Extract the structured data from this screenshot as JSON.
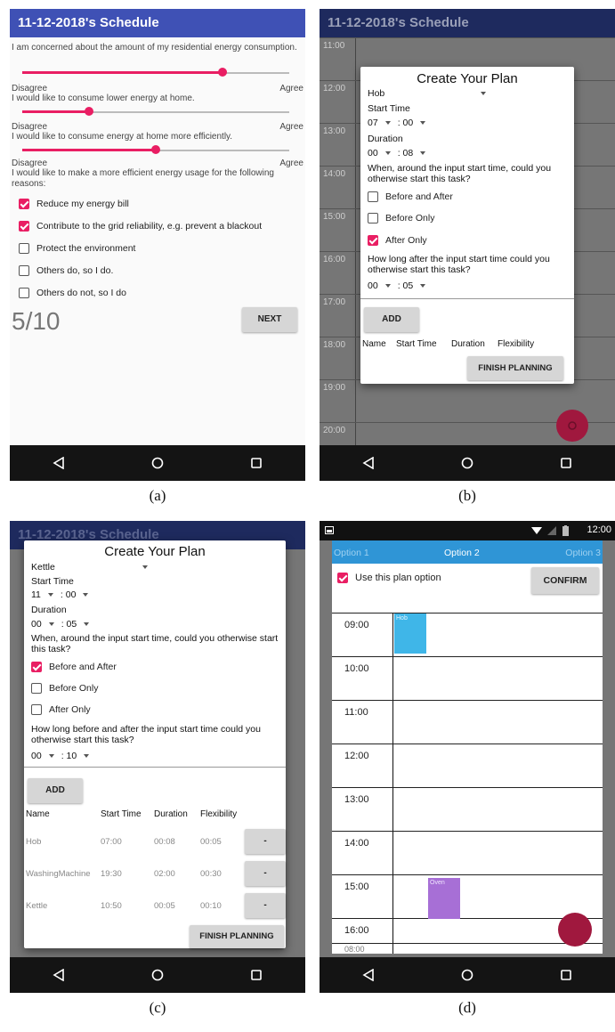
{
  "panels": {
    "a": {
      "label": "(a)",
      "app_title": "11-12-2018's Schedule",
      "questions": [
        {
          "text": "I am concerned about the amount of my residential energy consumption.",
          "value": 0.75
        },
        {
          "text": "I would like to consume lower energy at home.",
          "value": 0.25
        },
        {
          "text": "I would like to consume energy at home more efficiently.",
          "value": 0.5
        }
      ],
      "scale_min": "Disagree",
      "scale_max": "Agree",
      "reasons_prompt": "I would like to make a more efficient energy usage for the following reasons:",
      "reasons": [
        {
          "label": "Reduce my energy bill",
          "checked": true
        },
        {
          "label": "Contribute to the grid reliability, e.g. prevent a blackout",
          "checked": true
        },
        {
          "label": "Protect the environment",
          "checked": false
        },
        {
          "label": "Others do, so I do.",
          "checked": false
        },
        {
          "label": "Others do not, so I do",
          "checked": false
        }
      ],
      "progress": "5/10",
      "next_label": "NEXT"
    },
    "b": {
      "label": "(b)",
      "app_title": "11-12-2018's Schedule",
      "hours": [
        "11:00",
        "12:00",
        "13:00",
        "14:00",
        "15:00",
        "16:00",
        "17:00",
        "18:00",
        "19:00",
        "20:00"
      ],
      "dialog": {
        "title": "Create Your Plan",
        "appliance": "Hob",
        "start_time_label": "Start Time",
        "start_hour": "07",
        "start_min": "00",
        "duration_label": "Duration",
        "duration_hour": "00",
        "duration_min": "08",
        "question": "When, around the input start time, could you otherwise start this task?",
        "options": [
          {
            "label": "Before and After",
            "checked": false
          },
          {
            "label": "Before Only",
            "checked": false
          },
          {
            "label": "After Only",
            "checked": true
          }
        ],
        "flex_question": "How long after the input start time could you otherwise start this task?",
        "flex_hour": "00",
        "flex_min": "05",
        "add_label": "ADD",
        "columns": [
          "Name",
          "Start Time",
          "Duration",
          "Flexibility"
        ],
        "finish_label": "FINISH PLANNING"
      }
    },
    "c": {
      "label": "(c)",
      "background_title": "11-12-2018's Schedule",
      "dialog": {
        "title": "Create Your Plan",
        "appliance": "Kettle",
        "start_time_label": "Start Time",
        "start_hour": "11",
        "start_min": "00",
        "duration_label": "Duration",
        "duration_hour": "00",
        "duration_min": "05",
        "question": "When, around the input start time, could you otherwise start this task?",
        "options": [
          {
            "label": "Before and After",
            "checked": true
          },
          {
            "label": "Before Only",
            "checked": false
          },
          {
            "label": "After Only",
            "checked": false
          }
        ],
        "flex_question": "How long before and after the input start time could you otherwise start this task?",
        "flex_hour": "00",
        "flex_min": "10",
        "add_label": "ADD",
        "columns": [
          "Name",
          "Start Time",
          "Duration",
          "Flexibility"
        ],
        "rows": [
          {
            "name": "Hob",
            "start": "07:00",
            "duration": "00:08",
            "flex": "00:05",
            "remove": "-"
          },
          {
            "name": "WashingMachine",
            "start": "19:30",
            "duration": "02:00",
            "flex": "00:30",
            "remove": "-"
          },
          {
            "name": "Kettle",
            "start": "10:50",
            "duration": "00:05",
            "flex": "00:10",
            "remove": "-"
          }
        ],
        "finish_label": "FINISH PLANNING"
      }
    },
    "d": {
      "label": "(d)",
      "status_time": "12:00",
      "tabs": [
        "Option 1",
        "Option 2",
        "Option 3"
      ],
      "use_option_label": "Use this plan option",
      "use_option_checked": true,
      "confirm_label": "CONFIRM",
      "hours": [
        "09:00",
        "10:00",
        "11:00",
        "12:00",
        "13:00",
        "14:00",
        "15:00",
        "16:00"
      ],
      "peek_hour": "08:00",
      "events": [
        {
          "name": "Hob",
          "color": "#3fb6e8"
        },
        {
          "name": "Oven",
          "color": "#a76fd6"
        }
      ]
    }
  },
  "colors": {
    "appbar": "#3f51b5",
    "accent": "#e91e63",
    "nav": "#141414"
  }
}
